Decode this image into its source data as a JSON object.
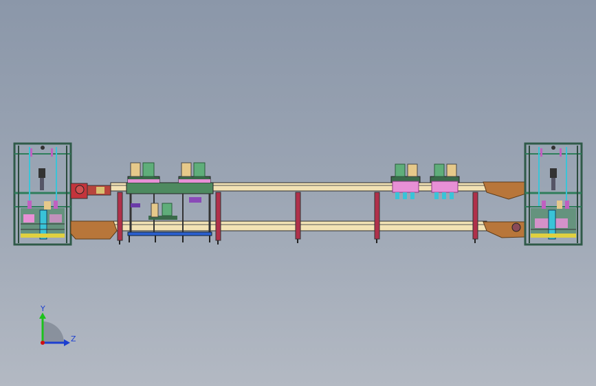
{
  "viewport": {
    "background_top": "#8b97a9",
    "background_bottom": "#b3b9c3"
  },
  "triad": {
    "y_label": "Y",
    "z_label": "Z",
    "y_color": "#1cc21c",
    "z_color": "#1d3fd0",
    "origin_color": "#d01010"
  },
  "colors": {
    "frame": "#3a4a4c",
    "frame_green": "#2e7d5a",
    "rail": "#f2e2b4",
    "rail_edge": "#2b2b2b",
    "wood": "#b8763a",
    "leg": "#b0304a",
    "cyan": "#39c4d8",
    "pink": "#e890d6",
    "tan": "#e6c98a",
    "green_block": "#5fae7a",
    "blue_bar": "#2a5fd0",
    "yellow": "#e0d040",
    "dark": "#222222"
  }
}
